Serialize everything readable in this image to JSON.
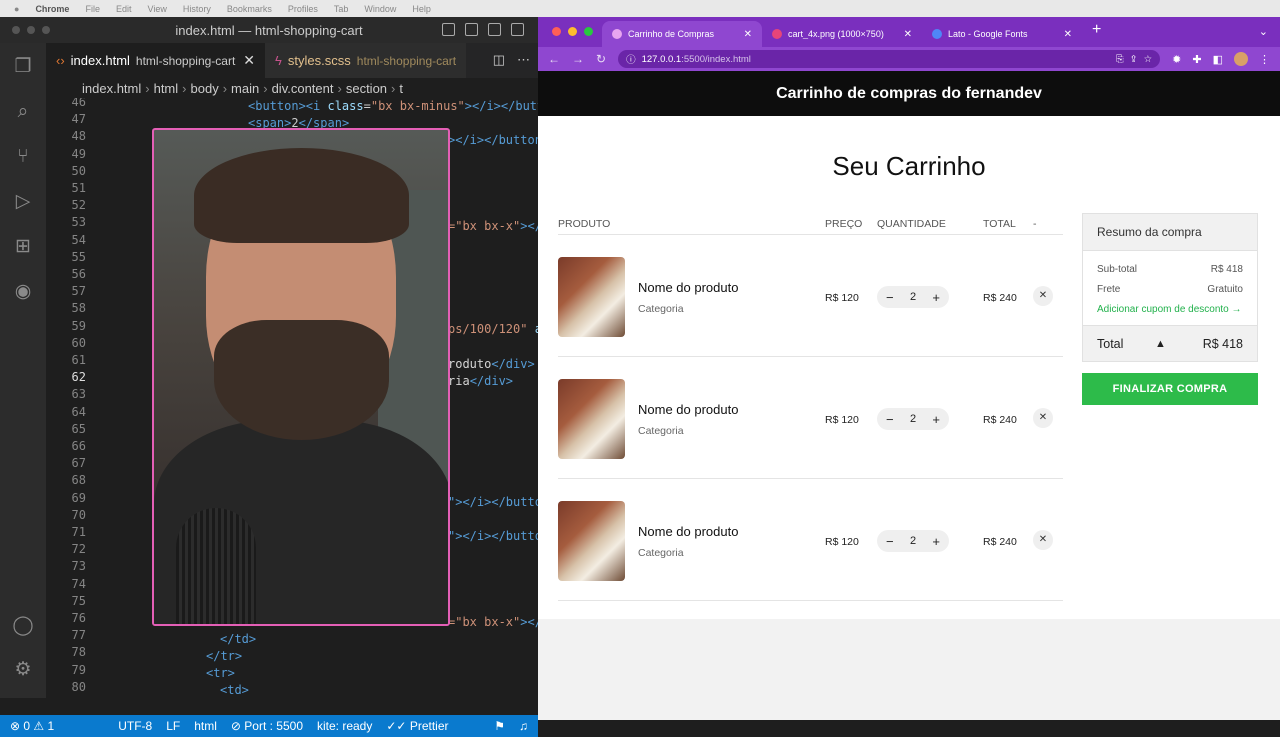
{
  "mac_menu": {
    "app": "Chrome",
    "items": [
      "File",
      "Edit",
      "View",
      "History",
      "Bookmarks",
      "Profiles",
      "Tab",
      "Window",
      "Help"
    ]
  },
  "vscode": {
    "window_title": "index.html — html-shopping-cart",
    "tabs": [
      {
        "name": "index.html",
        "path": "html-shopping-cart"
      },
      {
        "name": "styles.scss",
        "path": "html-shopping-cart"
      }
    ],
    "breadcrumbs": [
      "index.html",
      "html",
      "body",
      "main",
      "div.content",
      "section",
      "t"
    ],
    "line_numbers": [
      "46",
      "47",
      "48",
      "49",
      "50",
      "51",
      "52",
      "53",
      "54",
      "55",
      "56",
      "57",
      "58",
      "59",
      "60",
      "61",
      "62",
      "63",
      "64",
      "65",
      "66",
      "67",
      "68",
      "69",
      "70",
      "71",
      "72",
      "73",
      "74",
      "75",
      "76",
      "77",
      "78",
      "79",
      "80"
    ],
    "active_line": "62",
    "status": {
      "errors": "0",
      "warnings": "1",
      "encoding": "UTF-8",
      "eol": "LF",
      "language": "html",
      "port": "Port : 5500",
      "kite": "kite: ready",
      "prettier": "Prettier"
    }
  },
  "chrome": {
    "tabs": [
      {
        "title": "Carrinho de Compras",
        "fav": "#e7a5f0"
      },
      {
        "title": "cart_4x.png (1000×750)",
        "fav": "#e6457a"
      },
      {
        "title": "Lato - Google Fonts",
        "fav": "#4f86f7"
      }
    ],
    "url_host": "127.0.0.1",
    "url_rest": ":5500/index.html"
  },
  "site": {
    "header": "Carrinho de compras do fernandev",
    "title": "Seu Carrinho",
    "columns": {
      "product": "PRODUTO",
      "price": "PREÇO",
      "qty": "QUANTIDADE",
      "total": "TOTAL",
      "dash": "-"
    },
    "items": [
      {
        "name": "Nome do produto",
        "category": "Categoria",
        "price": "R$ 120",
        "qty": "2",
        "total": "R$ 240"
      },
      {
        "name": "Nome do produto",
        "category": "Categoria",
        "price": "R$ 120",
        "qty": "2",
        "total": "R$ 240"
      },
      {
        "name": "Nome do produto",
        "category": "Categoria",
        "price": "R$ 120",
        "qty": "2",
        "total": "R$ 240"
      }
    ],
    "summary": {
      "title": "Resumo da compra",
      "subtotal_label": "Sub-total",
      "subtotal": "R$ 418",
      "shipping_label": "Frete",
      "shipping": "Gratuito",
      "coupon": "Adicionar cupom de desconto →",
      "total_label": "Total",
      "total": "R$ 418"
    },
    "checkout": "FINALIZAR COMPRA"
  }
}
